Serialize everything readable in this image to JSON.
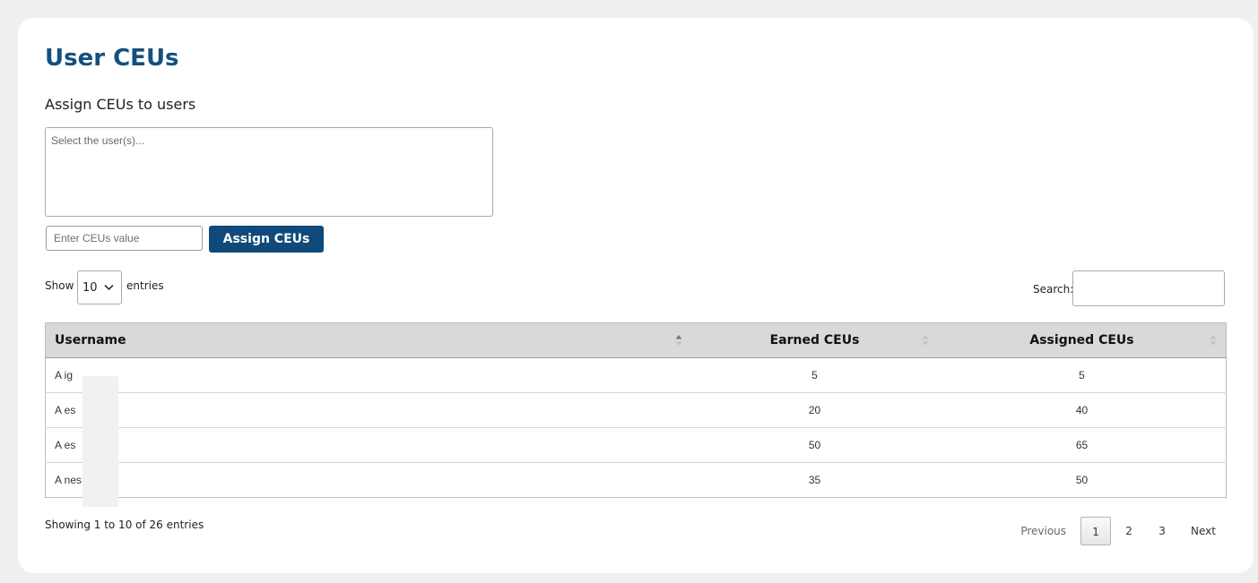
{
  "page": {
    "title": "User CEUs",
    "subtitle": "Assign CEUs to users"
  },
  "assign": {
    "users_placeholder": "Select the user(s)...",
    "ceus_placeholder": "Enter CEUs value",
    "button_label": "Assign CEUs"
  },
  "controls": {
    "show_label": "Show",
    "entries_value": "10",
    "entries_label": "entries",
    "search_label": "Search:",
    "search_value": ""
  },
  "table": {
    "columns": [
      "Username",
      "Earned CEUs",
      "Assigned CEUs"
    ],
    "rows": [
      {
        "username": "A        ig",
        "earned": "5",
        "assigned": "5"
      },
      {
        "username": "A        es",
        "earned": "20",
        "assigned": "40"
      },
      {
        "username": "A        es",
        "earned": "50",
        "assigned": "65"
      },
      {
        "username": "A        nes",
        "earned": "35",
        "assigned": "50"
      }
    ]
  },
  "footer": {
    "info": "Showing 1 to 10 of 26 entries",
    "previous": "Previous",
    "pages": [
      "1",
      "2",
      "3"
    ],
    "current_page": "1",
    "next": "Next"
  },
  "colors": {
    "accent": "#0f4a7a",
    "title": "#14507e",
    "background": "#eef0ef"
  }
}
